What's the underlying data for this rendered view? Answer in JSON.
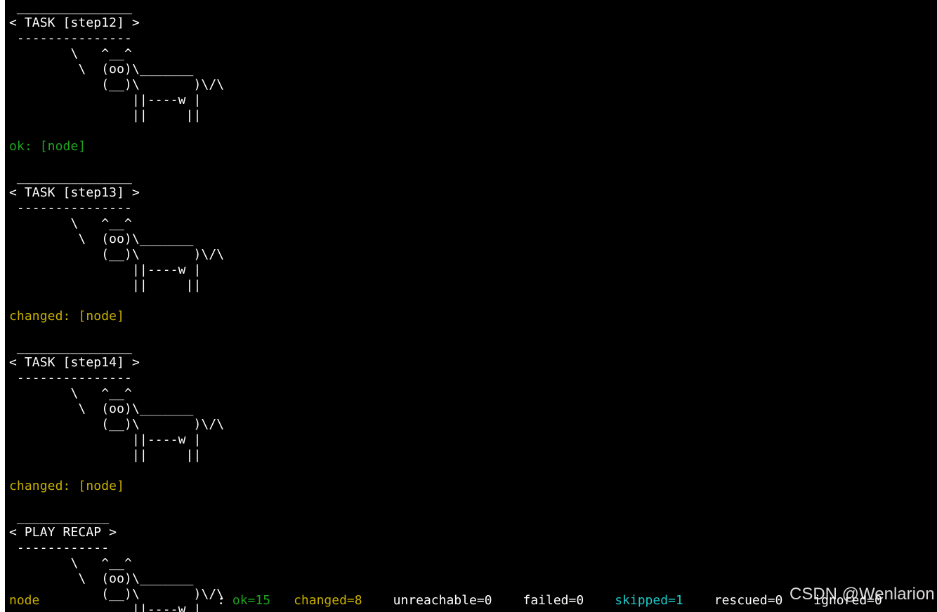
{
  "tasks": [
    {
      "bubble_top": " _______________",
      "bubble_text": "< TASK [step12] >",
      "bubble_bottom": " ---------------",
      "result": "ok: [node]",
      "result_class": "ok"
    },
    {
      "bubble_top": " _______________",
      "bubble_text": "< TASK [step13] >",
      "bubble_bottom": " ---------------",
      "result": "changed: [node]",
      "result_class": "changed"
    },
    {
      "bubble_top": " _______________",
      "bubble_text": "< TASK [step14] >",
      "bubble_bottom": " ---------------",
      "result": "changed: [node]",
      "result_class": "changed"
    },
    {
      "bubble_top": " ____________",
      "bubble_text": "< PLAY RECAP >",
      "bubble_bottom": " ------------",
      "result": "",
      "result_class": ""
    }
  ],
  "cow": [
    "        \\   ^__^",
    "         \\  (oo)\\_______",
    "            (__)\\       )\\/\\",
    "                ||----w |",
    "                ||     ||"
  ],
  "recap": {
    "host": "node",
    "colon": " : ",
    "ok": "ok=15",
    "changed": "changed=8",
    "unreachable": "unreachable=0",
    "failed": "failed=0",
    "skipped": "skipped=1",
    "rescued": "rescued=0",
    "ignored": "ignored=0"
  },
  "watermark": "CSDN @Wenlarion",
  "colors": {
    "background": "#000000",
    "ok": "#1fa31f",
    "changed": "#c8b000",
    "skipped": "#1ec8c8",
    "text": "#ffffff"
  }
}
